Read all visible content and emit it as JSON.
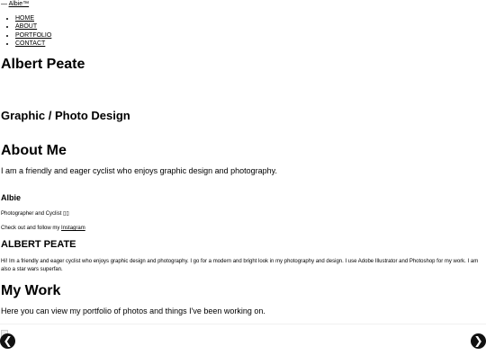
{
  "header": {
    "toggle_glyph": "—",
    "brand": "Albie™",
    "nav": [
      "HOME",
      "ABOUT",
      "PORTFOLIO",
      "CONTACT"
    ]
  },
  "hero": {
    "title": "Albert Peate",
    "tagline": "Graphic / Photo Design"
  },
  "about": {
    "heading": "About Me",
    "text": "I am a friendly and eager cyclist who enjoys graphic design and photography."
  },
  "profile": {
    "name": "Albie",
    "role": "Photographer and Cyclist ▯▯",
    "follow_prefix": "Check out and follow my ",
    "follow_link": "Instagram"
  },
  "bio": {
    "heading": "ALBERT PEATE",
    "text": "Hi! Im a friendly and eager cyclist who enjoys graphic design and photography. I go for a modern and bright look in my photography and design. I use Adobe Illustrator and Photoshop for my work. I am also a star wars superfan."
  },
  "work": {
    "heading": "My Work",
    "text": "Here you can view my portfolio of photos and things I've been working on."
  },
  "slider": {
    "prev_glyph": "❮",
    "next_glyph": "❯"
  }
}
